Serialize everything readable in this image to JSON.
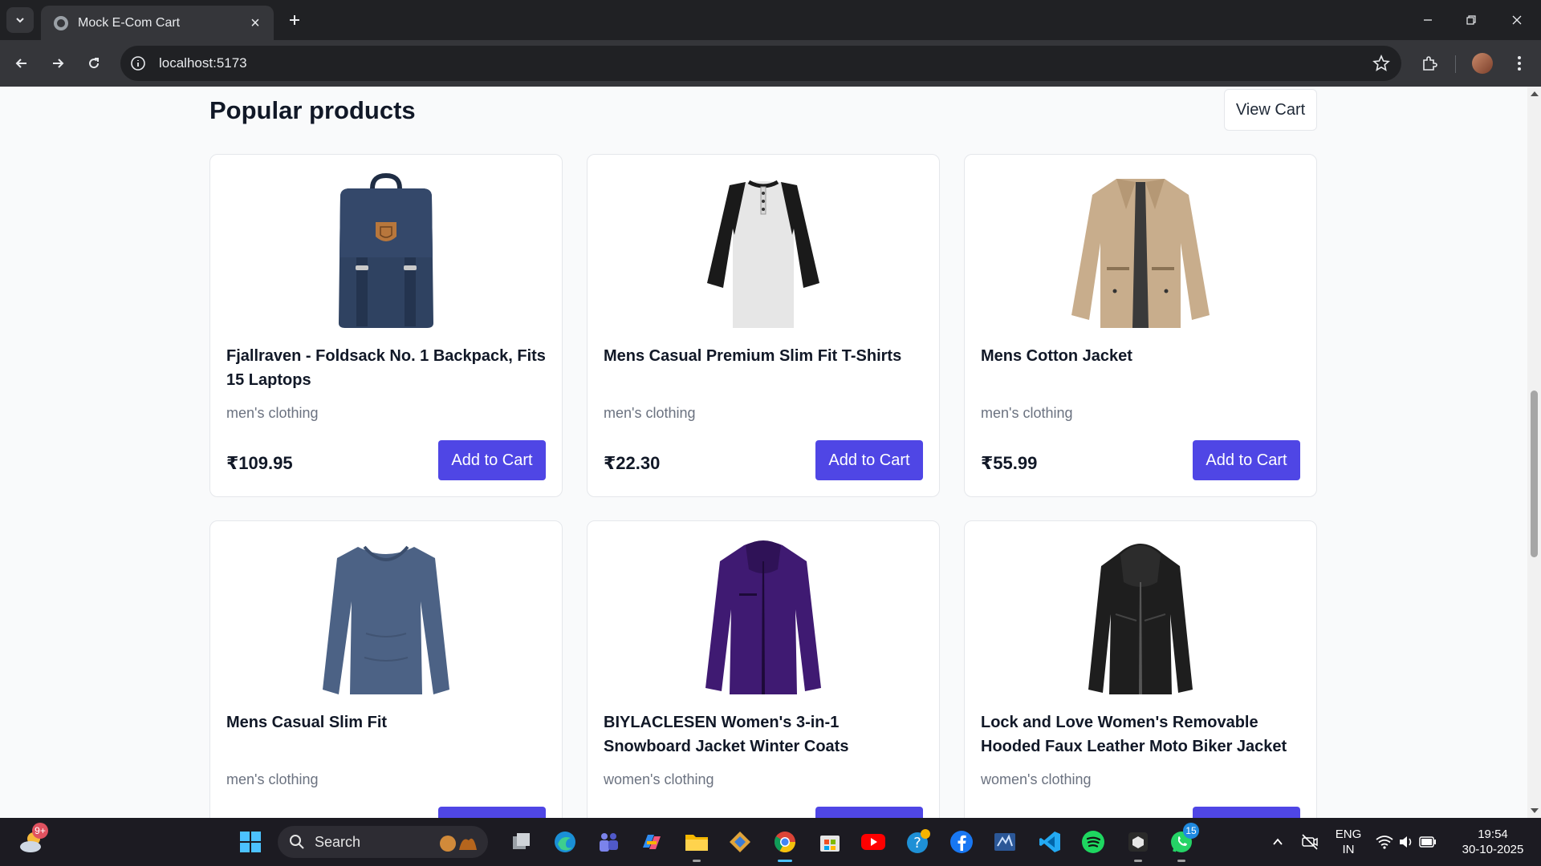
{
  "browser": {
    "tab_title": "Mock E-Com Cart",
    "url": "localhost:5173"
  },
  "page": {
    "title": "Popular products",
    "view_cart_label": "View Cart"
  },
  "products": [
    {
      "title": "Fjallraven - Foldsack No. 1 Backpack, Fits 15 Laptops",
      "category": "men's clothing",
      "price": "₹109.95",
      "button": "Add to Cart",
      "image": "backpack"
    },
    {
      "title": "Mens Casual Premium Slim Fit T-Shirts",
      "category": "men's clothing",
      "price": "₹22.30",
      "button": "Add to Cart",
      "image": "raglan-tshirt"
    },
    {
      "title": "Mens Cotton Jacket",
      "category": "men's clothing",
      "price": "₹55.99",
      "button": "Add to Cart",
      "image": "cotton-jacket"
    },
    {
      "title": "Mens Casual Slim Fit",
      "category": "men's clothing",
      "price": "",
      "button": "",
      "image": "long-sleeve-shirt"
    },
    {
      "title": "BIYLACLESEN Women's 3-in-1 Snowboard Jacket Winter Coats",
      "category": "women's clothing",
      "price": "",
      "button": "",
      "image": "snowboard-jacket"
    },
    {
      "title": "Lock and Love Women's Removable Hooded Faux Leather Moto Biker Jacket",
      "category": "women's clothing",
      "price": "",
      "button": "",
      "image": "leather-jacket"
    }
  ],
  "taskbar": {
    "search_placeholder": "Search",
    "weather_badge": "9+",
    "whatsapp_badge": "15",
    "lang_line1": "ENG",
    "lang_line2": "IN",
    "time": "19:54",
    "date": "30-10-2025"
  },
  "colors": {
    "accent": "#4f46e5",
    "page_bg": "#f9fafb",
    "card_bg": "#ffffff"
  }
}
